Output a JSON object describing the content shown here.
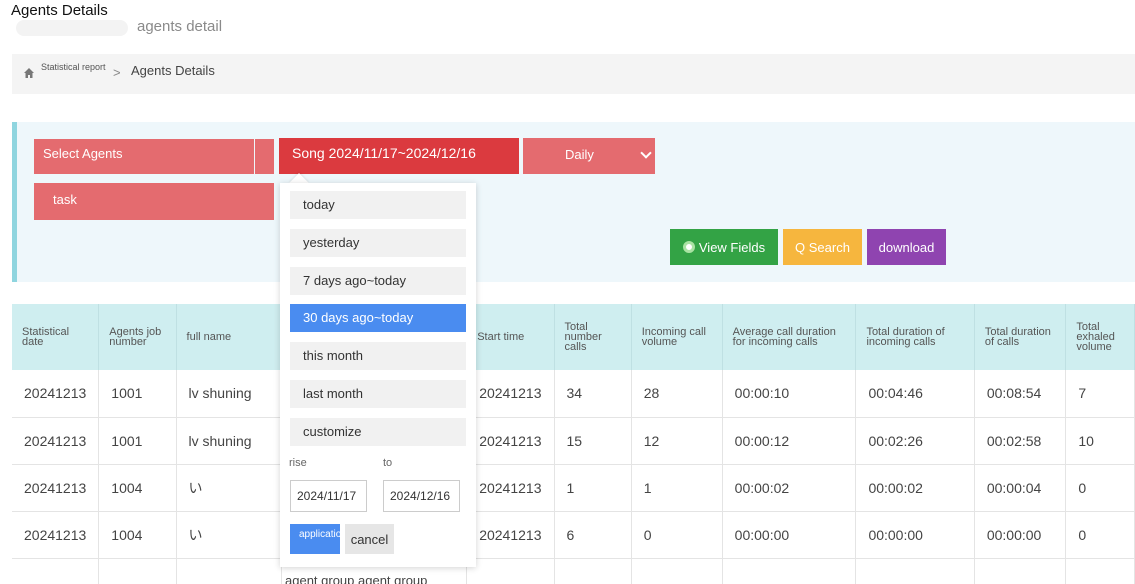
{
  "page": {
    "title": "Agents Details",
    "subtitle": "agents detail"
  },
  "breadcrumb": {
    "first": "Statistical report",
    "separator": ">",
    "current": "Agents Details"
  },
  "filters": {
    "agents_placeholder": "Select Agents",
    "date_range": "Song 2024/11/17~2024/12/16",
    "period": "Daily",
    "task": "task"
  },
  "actions": {
    "view_fields": "View Fields",
    "search": "Q Search",
    "download": "download"
  },
  "table": {
    "headers": [
      "Statistical date",
      "Agents job number",
      "full name",
      "",
      "Start time",
      "Total number calls",
      "Incoming call volume",
      "Average call duration for incoming calls",
      "Total duration of incoming calls",
      "Total duration of calls",
      "Total exhaled volume"
    ],
    "rows": [
      [
        "20241213",
        "1001",
        "lv shuning",
        "",
        "20241213",
        "34",
        "28",
        "00:00:10",
        "00:04:46",
        "00:08:54",
        "7"
      ],
      [
        "20241213",
        "1001",
        "lv shuning",
        "",
        "20241213",
        "15",
        "12",
        "00:00:12",
        "00:02:26",
        "00:02:58",
        "10"
      ],
      [
        "20241213",
        "1004",
        "い",
        "",
        "20241213",
        "1",
        "1",
        "00:00:02",
        "00:00:02",
        "00:00:04",
        "0"
      ],
      [
        "20241213",
        "1004",
        "い",
        "",
        "20241213",
        "6",
        "0",
        "00:00:00",
        "00:00:00",
        "00:00:00",
        "0"
      ]
    ],
    "overflow_text": "agent group agent group"
  },
  "date_dropdown": {
    "options": [
      "today",
      "yesterday",
      "7 days ago~today",
      "30 days ago~today",
      "this month",
      "last month",
      "customize"
    ],
    "active_option": "30 days ago~today",
    "rise_label": "rise",
    "to_label": "to",
    "rise_value": "2024/11/17",
    "to_value": "2024/12/16",
    "apply_label": "application",
    "cancel_label": "cancel"
  }
}
